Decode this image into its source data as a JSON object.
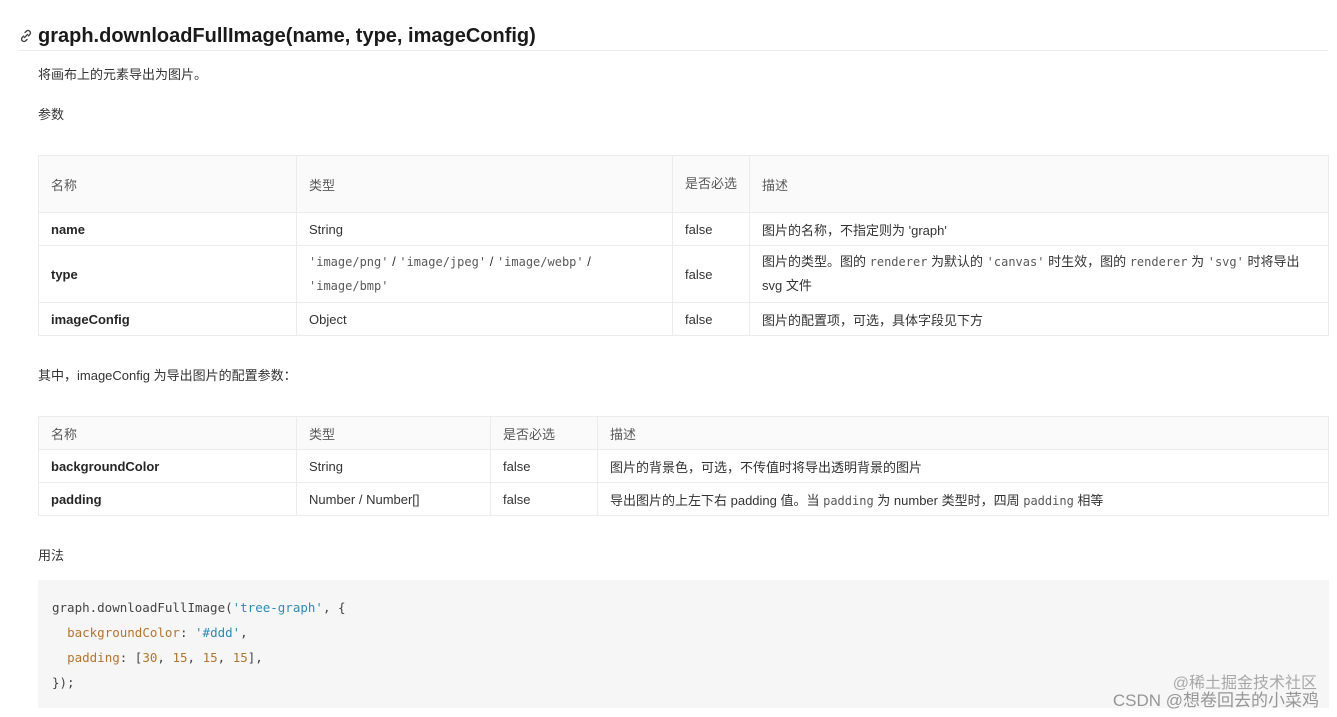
{
  "heading": "graph.downloadFullImage(name, type, imageConfig)",
  "intro": "将画布上的元素导出为图片。",
  "params_label": "参数",
  "table1": {
    "headers": [
      "名称",
      "类型",
      "是否必选",
      "描述"
    ],
    "rows": [
      {
        "name": "name",
        "type": "String",
        "required": "false",
        "desc": "图片的名称，不指定则为 'graph'"
      },
      {
        "name": "type",
        "type_codes": [
          "'image/png'",
          "'image/jpeg'",
          "'image/webp'",
          "'image/bmp'"
        ],
        "type_sep": "/",
        "required": "false",
        "desc_parts": [
          "图片的类型。图的 ",
          "renderer",
          " 为默认的 ",
          "'canvas'",
          " 时生效，图的 ",
          "renderer",
          " 为 ",
          "'svg'",
          " 时将导出 svg 文件"
        ]
      },
      {
        "name": "imageConfig",
        "type": "Object",
        "required": "false",
        "desc": "图片的配置项，可选，具体字段见下方"
      }
    ]
  },
  "config_intro": "其中，imageConfig 为导出图片的配置参数：",
  "table2": {
    "headers": [
      "名称",
      "类型",
      "是否必选",
      "描述"
    ],
    "rows": [
      {
        "name": "backgroundColor",
        "type": "String",
        "required": "false",
        "desc": "图片的背景色，可选，不传值时将导出透明背景的图片"
      },
      {
        "name": "padding",
        "type": "Number / Number[]",
        "required": "false",
        "desc_parts": [
          "导出图片的上左下右 padding 值。当 ",
          "padding",
          " 为 number 类型时，四周 ",
          "padding",
          " 相等"
        ]
      }
    ]
  },
  "usage_label": "用法",
  "code": {
    "line1_fn": "graph.downloadFullImage(",
    "line1_str": "'tree-graph'",
    "line1_end": ", {",
    "line2_key": "backgroundColor",
    "line2_colon": ": ",
    "line2_val": "'#ddd'",
    "line2_end": ",",
    "line3_key": "padding",
    "line3_colon": ": [",
    "line3_n1": "30",
    "line3_n2": "15",
    "line3_n3": "15",
    "line3_n4": "15",
    "line3_end": "],",
    "line4": "});"
  },
  "watermark": "CSDN @想卷回去的小菜鸡",
  "watermark_overlay": "@稀土掘金技术社区",
  "icons": {
    "heading_link": "link-icon"
  }
}
